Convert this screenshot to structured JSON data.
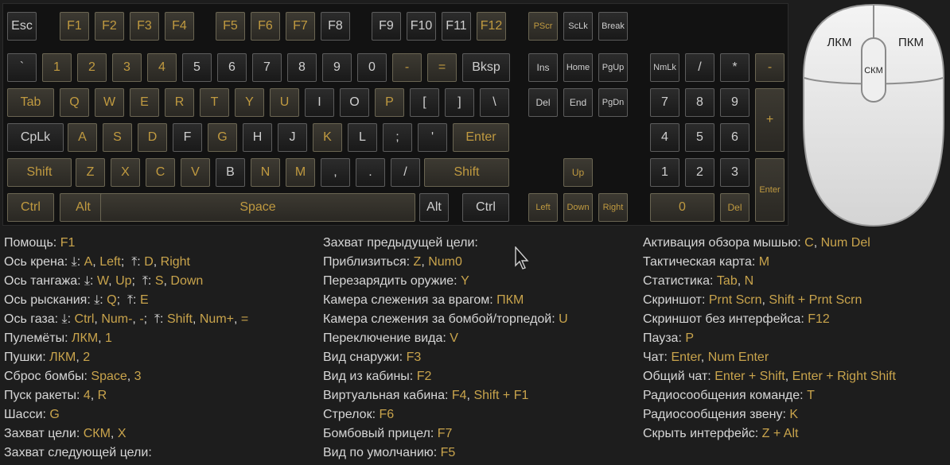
{
  "colors": {
    "background": "#1d1d1d",
    "key_text": "#cfcfcf",
    "key_active_text": "#c09a40",
    "help_text": "#d6d6d6",
    "help_value": "#c9a44c",
    "mouse_body": "#e9e9e9"
  },
  "keyboard": {
    "keys": [
      {
        "label": "Esc",
        "active": false
      },
      {
        "label": "F1",
        "active": true
      },
      {
        "label": "F2",
        "active": true
      },
      {
        "label": "F3",
        "active": true
      },
      {
        "label": "F4",
        "active": true
      },
      {
        "label": "F5",
        "active": true
      },
      {
        "label": "F6",
        "active": true
      },
      {
        "label": "F7",
        "active": true
      },
      {
        "label": "F8",
        "active": false
      },
      {
        "label": "F9",
        "active": false
      },
      {
        "label": "F10",
        "active": false
      },
      {
        "label": "F11",
        "active": false
      },
      {
        "label": "F12",
        "active": true
      },
      {
        "label": "PScr",
        "active": true
      },
      {
        "label": "ScLk",
        "active": false
      },
      {
        "label": "Break",
        "active": false
      },
      {
        "label": "`",
        "active": false
      },
      {
        "label": "1",
        "active": true
      },
      {
        "label": "2",
        "active": true
      },
      {
        "label": "3",
        "active": true
      },
      {
        "label": "4",
        "active": true
      },
      {
        "label": "5",
        "active": false
      },
      {
        "label": "6",
        "active": false
      },
      {
        "label": "7",
        "active": false
      },
      {
        "label": "8",
        "active": false
      },
      {
        "label": "9",
        "active": false
      },
      {
        "label": "0",
        "active": false
      },
      {
        "label": "-",
        "active": true
      },
      {
        "label": "=",
        "active": true
      },
      {
        "label": "Bksp",
        "active": false
      },
      {
        "label": "Ins",
        "active": false
      },
      {
        "label": "Home",
        "active": false
      },
      {
        "label": "PgUp",
        "active": false
      },
      {
        "label": "NmLk",
        "active": false
      },
      {
        "label": "/",
        "active": false
      },
      {
        "label": "*",
        "active": false
      },
      {
        "label": "-",
        "active": true
      },
      {
        "label": "Tab",
        "active": true
      },
      {
        "label": "Q",
        "active": true
      },
      {
        "label": "W",
        "active": true
      },
      {
        "label": "E",
        "active": true
      },
      {
        "label": "R",
        "active": true
      },
      {
        "label": "T",
        "active": true
      },
      {
        "label": "Y",
        "active": true
      },
      {
        "label": "U",
        "active": true
      },
      {
        "label": "I",
        "active": false
      },
      {
        "label": "O",
        "active": false
      },
      {
        "label": "P",
        "active": true
      },
      {
        "label": "[",
        "active": false
      },
      {
        "label": "]",
        "active": false
      },
      {
        "label": "\\",
        "active": false
      },
      {
        "label": "Del",
        "active": false
      },
      {
        "label": "End",
        "active": false
      },
      {
        "label": "PgDn",
        "active": false
      },
      {
        "label": "7",
        "active": false
      },
      {
        "label": "8",
        "active": false
      },
      {
        "label": "9",
        "active": false
      },
      {
        "label": "+",
        "active": true
      },
      {
        "label": "CpLk",
        "active": false
      },
      {
        "label": "A",
        "active": true
      },
      {
        "label": "S",
        "active": true
      },
      {
        "label": "D",
        "active": true
      },
      {
        "label": "F",
        "active": false
      },
      {
        "label": "G",
        "active": true
      },
      {
        "label": "H",
        "active": false
      },
      {
        "label": "J",
        "active": false
      },
      {
        "label": "K",
        "active": true
      },
      {
        "label": "L",
        "active": false
      },
      {
        "label": ";",
        "active": false
      },
      {
        "label": "'",
        "active": false
      },
      {
        "label": "Enter",
        "active": true
      },
      {
        "label": "4",
        "active": false
      },
      {
        "label": "5",
        "active": false
      },
      {
        "label": "6",
        "active": false
      },
      {
        "label": "Shift",
        "active": true
      },
      {
        "label": "Z",
        "active": true
      },
      {
        "label": "X",
        "active": true
      },
      {
        "label": "C",
        "active": true
      },
      {
        "label": "V",
        "active": true
      },
      {
        "label": "B",
        "active": false
      },
      {
        "label": "N",
        "active": true
      },
      {
        "label": "M",
        "active": true
      },
      {
        "label": ",",
        "active": false
      },
      {
        "label": ".",
        "active": false
      },
      {
        "label": "/",
        "active": false
      },
      {
        "label": "Shift",
        "active": true
      },
      {
        "label": "Up",
        "active": true
      },
      {
        "label": "1",
        "active": false
      },
      {
        "label": "2",
        "active": false
      },
      {
        "label": "3",
        "active": false
      },
      {
        "label": "Enter",
        "active": true
      },
      {
        "label": "Ctrl",
        "active": true
      },
      {
        "label": "Alt",
        "active": true
      },
      {
        "label": "Space",
        "active": true
      },
      {
        "label": "Alt",
        "active": false
      },
      {
        "label": "Ctrl",
        "active": false
      },
      {
        "label": "Left",
        "active": true
      },
      {
        "label": "Down",
        "active": true
      },
      {
        "label": "Right",
        "active": true
      },
      {
        "label": "0",
        "active": true
      },
      {
        "label": "Del",
        "active": true
      }
    ]
  },
  "mouse": {
    "left": "ЛКМ",
    "right": "ПКМ",
    "middle": "СКМ"
  },
  "help": {
    "columns": [
      [
        [
          {
            "t": "Помощь: "
          },
          {
            "t": "F1",
            "v": true
          }
        ],
        [
          {
            "t": "Ось крена: ⤓: "
          },
          {
            "t": "A",
            "v": true
          },
          {
            "t": ", "
          },
          {
            "t": "Left",
            "v": true
          },
          {
            "t": ";  ⤒: "
          },
          {
            "t": "D",
            "v": true
          },
          {
            "t": ", "
          },
          {
            "t": "Right",
            "v": true
          }
        ],
        [
          {
            "t": "Ось тангажа: ⤓: "
          },
          {
            "t": "W",
            "v": true
          },
          {
            "t": ", "
          },
          {
            "t": "Up",
            "v": true
          },
          {
            "t": ";  ⤒: "
          },
          {
            "t": "S",
            "v": true
          },
          {
            "t": ", "
          },
          {
            "t": "Down",
            "v": true
          }
        ],
        [
          {
            "t": "Ось рыскания: ⤓: "
          },
          {
            "t": "Q",
            "v": true
          },
          {
            "t": ";  ⤒: "
          },
          {
            "t": "E",
            "v": true
          }
        ],
        [
          {
            "t": "Ось газа: ⤓: "
          },
          {
            "t": "Ctrl",
            "v": true
          },
          {
            "t": ", "
          },
          {
            "t": "Num-",
            "v": true
          },
          {
            "t": ", "
          },
          {
            "t": "-",
            "v": true
          },
          {
            "t": ";  ⤒: "
          },
          {
            "t": "Shift",
            "v": true
          },
          {
            "t": ", "
          },
          {
            "t": "Num+",
            "v": true
          },
          {
            "t": ", "
          },
          {
            "t": "=",
            "v": true
          }
        ],
        [
          {
            "t": "Пулемёты: "
          },
          {
            "t": "ЛКМ",
            "v": true
          },
          {
            "t": ", "
          },
          {
            "t": "1",
            "v": true
          }
        ],
        [
          {
            "t": "Пушки: "
          },
          {
            "t": "ЛКМ",
            "v": true
          },
          {
            "t": ", "
          },
          {
            "t": "2",
            "v": true
          }
        ],
        [
          {
            "t": "Сброс бомбы: "
          },
          {
            "t": "Space",
            "v": true
          },
          {
            "t": ", "
          },
          {
            "t": "3",
            "v": true
          }
        ],
        [
          {
            "t": "Пуск ракеты: "
          },
          {
            "t": "4",
            "v": true
          },
          {
            "t": ", "
          },
          {
            "t": "R",
            "v": true
          }
        ],
        [
          {
            "t": "Шасси: "
          },
          {
            "t": "G",
            "v": true
          }
        ],
        [
          {
            "t": "Захват цели: "
          },
          {
            "t": "СКМ",
            "v": true
          },
          {
            "t": ", "
          },
          {
            "t": "X",
            "v": true
          }
        ],
        [
          {
            "t": "Захват следующей цели:"
          }
        ]
      ],
      [
        [
          {
            "t": "Захват предыдущей цели:"
          }
        ],
        [
          {
            "t": "Приблизиться: "
          },
          {
            "t": "Z",
            "v": true
          },
          {
            "t": ", "
          },
          {
            "t": "Num0",
            "v": true
          }
        ],
        [
          {
            "t": "Перезарядить оружие: "
          },
          {
            "t": "Y",
            "v": true
          }
        ],
        [
          {
            "t": "Камера слежения за врагом: "
          },
          {
            "t": "ПКМ",
            "v": true
          }
        ],
        [
          {
            "t": "Камера слежения за бомбой/торпедой: "
          },
          {
            "t": "U",
            "v": true
          }
        ],
        [
          {
            "t": "Переключение вида: "
          },
          {
            "t": "V",
            "v": true
          }
        ],
        [
          {
            "t": "Вид снаружи: "
          },
          {
            "t": "F3",
            "v": true
          }
        ],
        [
          {
            "t": "Вид из кабины: "
          },
          {
            "t": "F2",
            "v": true
          }
        ],
        [
          {
            "t": "Виртуальная кабина: "
          },
          {
            "t": "F4",
            "v": true
          },
          {
            "t": ", "
          },
          {
            "t": "Shift + F1",
            "v": true
          }
        ],
        [
          {
            "t": "Стрелок: "
          },
          {
            "t": "F6",
            "v": true
          }
        ],
        [
          {
            "t": "Бомбовый прицел: "
          },
          {
            "t": "F7",
            "v": true
          }
        ],
        [
          {
            "t": "Вид по умолчанию: "
          },
          {
            "t": "F5",
            "v": true
          }
        ]
      ],
      [
        [
          {
            "t": "Активация обзора мышью: "
          },
          {
            "t": "C",
            "v": true
          },
          {
            "t": ", "
          },
          {
            "t": "Num Del",
            "v": true
          }
        ],
        [
          {
            "t": "Тактическая карта: "
          },
          {
            "t": "M",
            "v": true
          }
        ],
        [
          {
            "t": "Статистика: "
          },
          {
            "t": "Tab",
            "v": true
          },
          {
            "t": ", "
          },
          {
            "t": "N",
            "v": true
          }
        ],
        [
          {
            "t": "Скриншот: "
          },
          {
            "t": "Prnt Scrn",
            "v": true
          },
          {
            "t": ", "
          },
          {
            "t": "Shift + Prnt Scrn",
            "v": true
          }
        ],
        [
          {
            "t": "Скриншот без интерфейса: "
          },
          {
            "t": "F12",
            "v": true
          }
        ],
        [
          {
            "t": "Пауза: "
          },
          {
            "t": "P",
            "v": true
          }
        ],
        [
          {
            "t": "Чат: "
          },
          {
            "t": "Enter",
            "v": true
          },
          {
            "t": ", "
          },
          {
            "t": "Num Enter",
            "v": true
          }
        ],
        [
          {
            "t": "Общий чат: "
          },
          {
            "t": "Enter + Shift",
            "v": true
          },
          {
            "t": ", "
          },
          {
            "t": "Enter + Right Shift",
            "v": true
          }
        ],
        [
          {
            "t": "Радиосообщения команде: "
          },
          {
            "t": "T",
            "v": true
          }
        ],
        [
          {
            "t": "Радиосообщения звену: "
          },
          {
            "t": "K",
            "v": true
          }
        ],
        [
          {
            "t": "Скрыть интерфейс: "
          },
          {
            "t": "Z + Alt",
            "v": true
          }
        ]
      ]
    ]
  }
}
